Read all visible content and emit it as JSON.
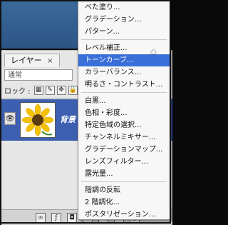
{
  "layers_panel": {
    "tab_label": "レイヤー",
    "tab_close": "×",
    "blend_mode": "通常",
    "lock_label": "ロック :",
    "layer_name": "背景"
  },
  "menu": {
    "items": [
      "べた塗り...",
      "グラデーション...",
      "パターン...",
      "レベル補正...",
      "トーンカーブ...",
      "カラーバランス...",
      "明るさ・コントラスト...",
      "白黒...",
      "色相・彩度...",
      "特定色域の選択...",
      "チャンネルミキサー...",
      "グラデーションマップ...",
      "レンズフィルター...",
      "露光量...",
      "階調の反転",
      "2 階調化...",
      "ポスタリゼーション..."
    ],
    "highlighted_index": 4
  },
  "colors": {
    "highlight": "#3a6fd8",
    "layer_selected": "#3d5fb0"
  }
}
